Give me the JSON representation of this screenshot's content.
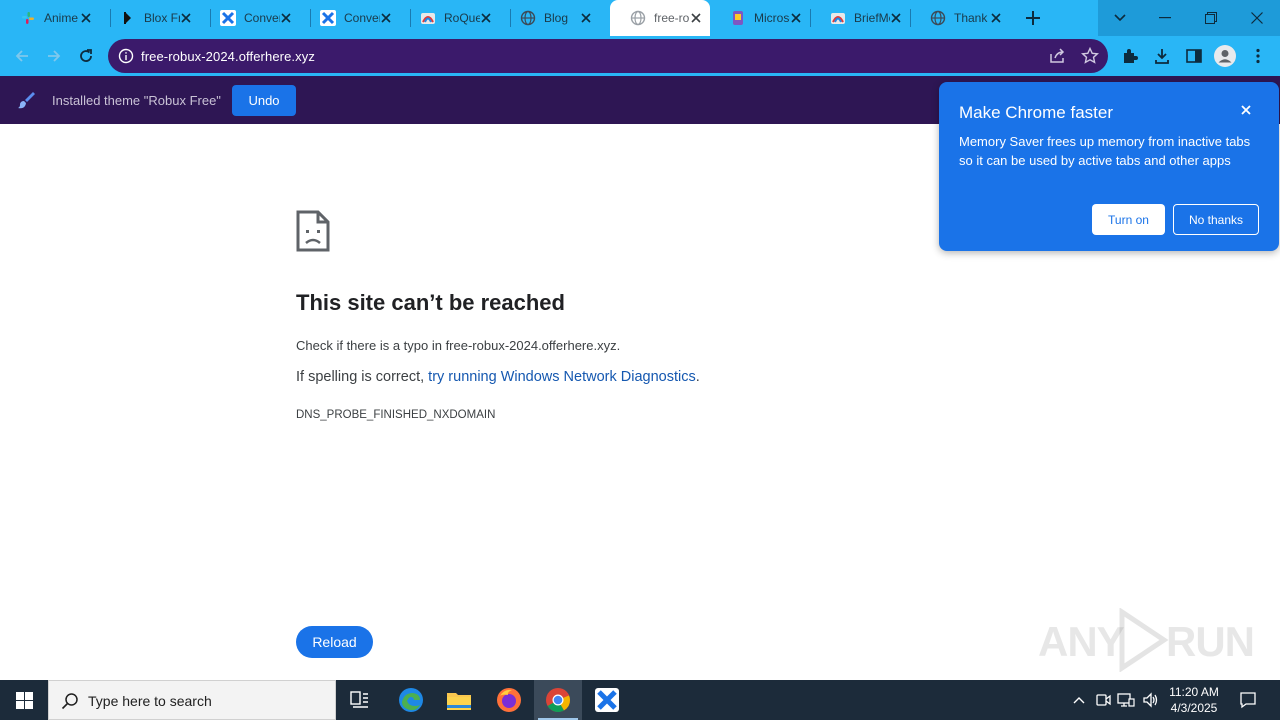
{
  "browser": {
    "tabs": [
      {
        "title": "Anime",
        "icon": "slack-like-icon"
      },
      {
        "title": "Blox Fruits",
        "icon": "blox-icon"
      },
      {
        "title": "Convert",
        "icon": "convert-icon"
      },
      {
        "title": "Convert",
        "icon": "convert-icon"
      },
      {
        "title": "RoQuest",
        "icon": "roblox-icon"
      },
      {
        "title": "Blog",
        "icon": "globe-icon"
      },
      {
        "title": "free-robux",
        "icon": "globe-icon",
        "active": true
      },
      {
        "title": "Microsoft",
        "icon": "microsoft-icon"
      },
      {
        "title": "BriefMe",
        "icon": "briefme-icon"
      },
      {
        "title": "Thank",
        "icon": "globe-icon"
      }
    ],
    "url": "free-robux-2024.offerhere.xyz",
    "colors": {
      "frame": "#29b6f6",
      "omnibox": "#3b1a6b",
      "infobar": "#2e1654",
      "accent": "#1a73e8"
    }
  },
  "infobar": {
    "text": "Installed theme \"Robux Free\"",
    "undo_label": "Undo"
  },
  "error_page": {
    "title": "This site can’t be reached",
    "line1": "Check if there is a typo in free-robux-2024.offerhere.xyz.",
    "line2_prefix": "If spelling is correct, ",
    "line2_link": "try running Windows Network Diagnostics",
    "line2_suffix": ".",
    "error_code": "DNS_PROBE_FINISHED_NXDOMAIN",
    "reload_label": "Reload"
  },
  "promo_bubble": {
    "title": "Make Chrome faster",
    "body": "Memory Saver frees up memory from inactive tabs so it can be used by active tabs and other apps",
    "turn_on_label": "Turn on",
    "no_thanks_label": "No thanks"
  },
  "watermark": {
    "left": "ANY",
    "right": "RUN"
  },
  "taskbar": {
    "search_placeholder": "Type here to search",
    "time": "11:20 AM",
    "date": "4/3/2025"
  }
}
